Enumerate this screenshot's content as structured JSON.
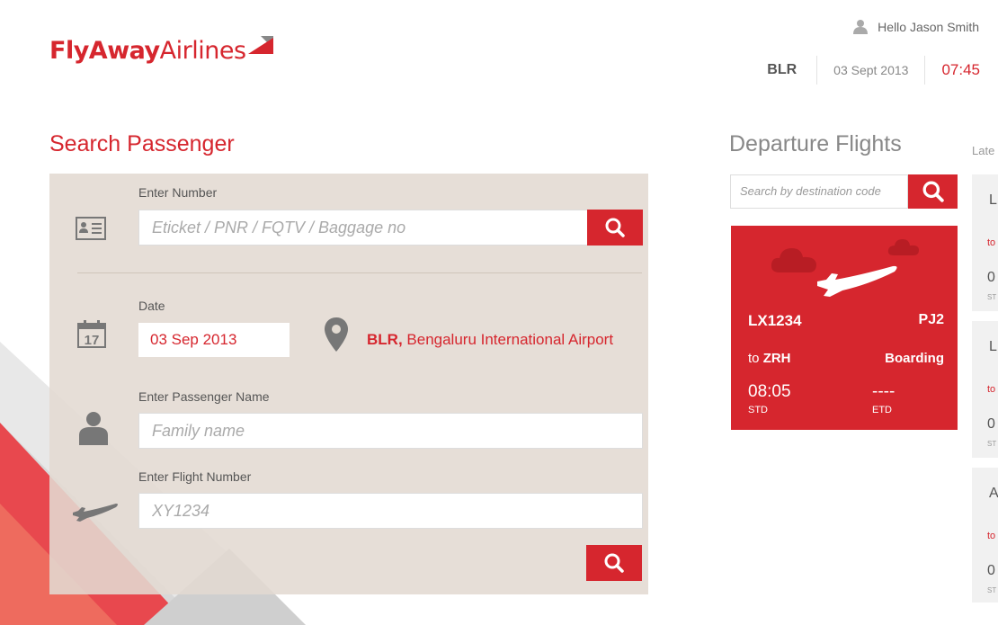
{
  "header": {
    "logo_part1": "FlyAway",
    "logo_part2": "Airlines",
    "greeting": "Hello Jason Smith",
    "airport_code": "BLR",
    "date": "03 Sept 2013",
    "time": "07:45"
  },
  "search_passenger": {
    "title": "Search Passenger",
    "number_label": "Enter Number",
    "number_placeholder": "Eticket / PNR / FQTV / Baggage no",
    "date_label": "Date",
    "date_value": "03 Sep 2013",
    "airport_code": "BLR,",
    "airport_name": " Bengaluru International Airport",
    "calendar_day": "17",
    "name_label": "Enter Passenger Name",
    "name_placeholder": "Family name",
    "flight_label": "Enter Flight Number",
    "flight_placeholder": "XY1234"
  },
  "departure_flights": {
    "title": "Departure Flights",
    "latest_label": "Late",
    "search_placeholder": "Search by destination code",
    "featured_flight": {
      "code": "LX1234",
      "gate": "PJ2",
      "to_prefix": "to",
      "destination": "ZRH",
      "status": "Boarding",
      "std": "08:05",
      "std_label": "STD",
      "etd": "----",
      "etd_label": "ETD"
    },
    "latest_cards": [
      {
        "title": "L",
        "to": "to",
        "num": "0",
        "std": "ST"
      },
      {
        "title": "L",
        "to": "to",
        "num": "0",
        "std": "ST"
      },
      {
        "title": "A",
        "to": "to",
        "num": "0",
        "std": "ST"
      }
    ]
  },
  "colors": {
    "brand_red": "#d6262e",
    "panel_beige": "#e2dad1",
    "text_gray": "#555555"
  },
  "icons": [
    "user-icon",
    "search-icon",
    "id-card-icon",
    "calendar-icon",
    "map-pin-icon",
    "person-icon",
    "airplane-icon",
    "cloud-icon"
  ]
}
